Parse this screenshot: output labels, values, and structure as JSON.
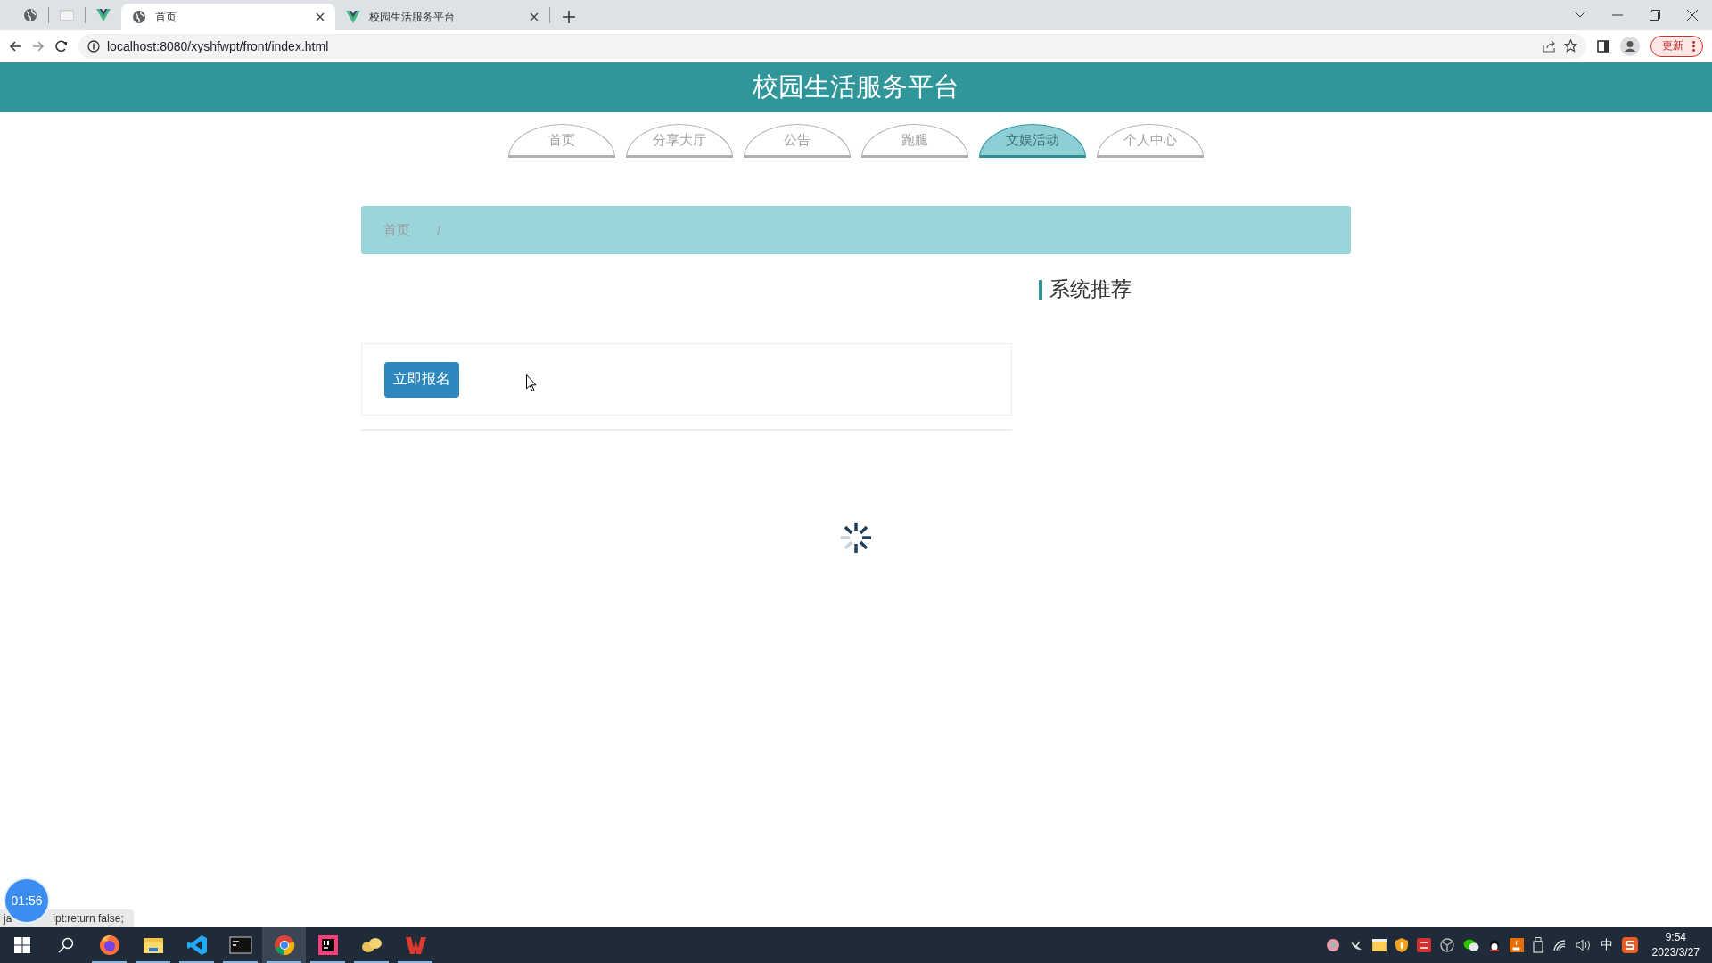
{
  "browser": {
    "tabs": [
      {
        "title": "首页",
        "selected": true
      },
      {
        "title": "校园生活服务平台",
        "selected": false
      }
    ],
    "address": "localhost:8080/xyshfwpt/front/index.html",
    "update_button": "更新"
  },
  "page": {
    "title": "校园生活服务平台",
    "nav": [
      {
        "label": "首页",
        "selected": false
      },
      {
        "label": "分享大厅",
        "selected": false
      },
      {
        "label": "公告",
        "selected": false
      },
      {
        "label": "跑腿",
        "selected": false
      },
      {
        "label": "文娱活动",
        "selected": true
      },
      {
        "label": "个人中心",
        "selected": false
      }
    ],
    "breadcrumb": [
      "首页",
      "/"
    ],
    "recommend_title": "系统推荐",
    "signup_button": "立即报名",
    "loading": true
  },
  "overlay": {
    "timer": "01:56",
    "status_parts": [
      "ja",
      "ipt:return false;"
    ]
  },
  "taskbar": {
    "apps": [
      {
        "kind": "firefox",
        "selected": false
      },
      {
        "kind": "folder",
        "selected": false
      },
      {
        "kind": "code",
        "selected": false
      },
      {
        "kind": "terminal",
        "selected": false
      },
      {
        "kind": "chrome",
        "selected": true
      },
      {
        "kind": "ide",
        "selected": false
      },
      {
        "kind": "app",
        "selected": false
      },
      {
        "kind": "office",
        "selected": false
      }
    ],
    "ime": "中",
    "time": "9:54",
    "date": "2023/3/27"
  }
}
